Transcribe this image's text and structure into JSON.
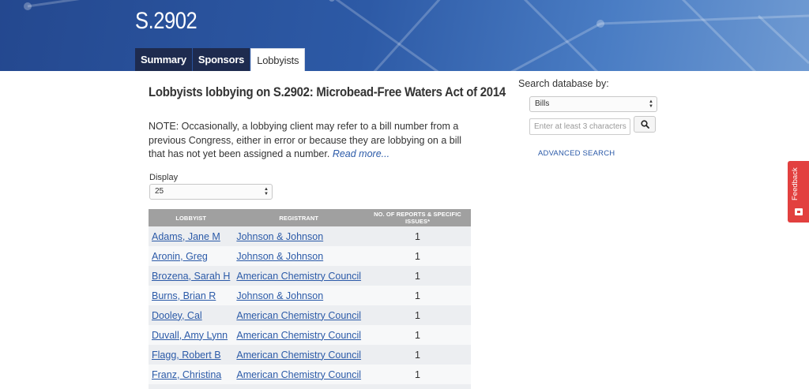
{
  "header": {
    "bill_title": "S.2902",
    "tabs": [
      {
        "label": "Summary",
        "active": false
      },
      {
        "label": "Sponsors",
        "active": false
      },
      {
        "label": "Lobbyists",
        "active": true
      }
    ]
  },
  "main": {
    "heading": "Lobbyists lobbying on S.2902: Microbead-Free Waters Act of 2014",
    "note_text": "NOTE: Occasionally, a lobbying client may refer to a bill number from a previous Congress, either in error or because they are lobbying on a bill that has not yet been assigned a number.",
    "read_more": "Read more...",
    "display_label": "Display",
    "display_value": "25",
    "table": {
      "headers": [
        "LOBBYIST",
        "REGISTRANT",
        "NO. OF REPORTS & SPECIFIC ISSUES*"
      ],
      "rows": [
        {
          "lobbyist": "Adams, Jane M",
          "registrant": "Johnson & Johnson",
          "count": "1"
        },
        {
          "lobbyist": "Aronin, Greg",
          "registrant": "Johnson & Johnson",
          "count": "1"
        },
        {
          "lobbyist": "Brozena, Sarah H",
          "registrant": "American Chemistry Council",
          "count": "1"
        },
        {
          "lobbyist": "Burns, Brian R",
          "registrant": "Johnson & Johnson",
          "count": "1"
        },
        {
          "lobbyist": "Dooley, Cal",
          "registrant": "American Chemistry Council",
          "count": "1"
        },
        {
          "lobbyist": "Duvall, Amy Lynn",
          "registrant": "American Chemistry Council",
          "count": "1"
        },
        {
          "lobbyist": "Flagg, Robert B",
          "registrant": "American Chemistry Council",
          "count": "1"
        },
        {
          "lobbyist": "Franz, Christina",
          "registrant": "American Chemistry Council",
          "count": "1"
        }
      ]
    }
  },
  "sidebar": {
    "search_label": "Search database by:",
    "search_type": "Bills",
    "search_placeholder": "Enter at least 3 characters",
    "advanced_search": "ADVANCED SEARCH"
  },
  "feedback": {
    "label": "Feedback"
  },
  "colors": {
    "banner": "#2d5aa6",
    "tab_dark": "#1e2b4f",
    "link": "#2b5aa8",
    "table_header": "#a0a0a0",
    "feedback": "#e2403f"
  },
  "icons": {
    "search_button": "search-icon",
    "select": "chevron-updown-icon",
    "feedback": "chat-icon"
  }
}
